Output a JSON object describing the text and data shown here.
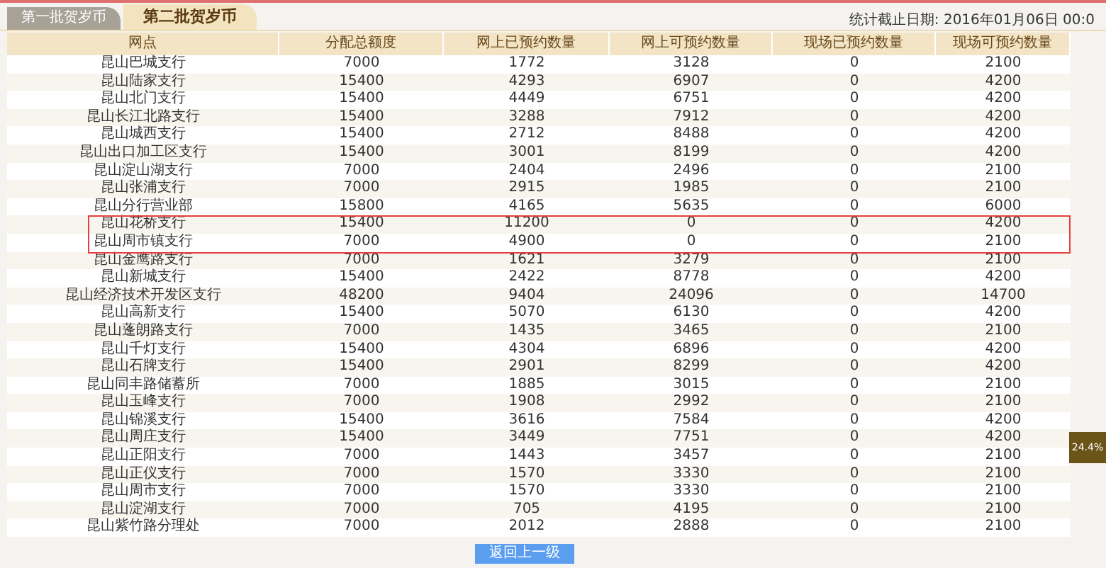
{
  "tabs": [
    {
      "label": "第一批贺岁币",
      "selected": false
    },
    {
      "label": "第二批贺岁币",
      "selected": true
    }
  ],
  "stat_date": "统计截止日期: 2016年01月06日 00:0",
  "table": {
    "columns": [
      "网点",
      "分配总额度",
      "网上已预约数量",
      "网上可预约数量",
      "现场已预约数量",
      "现场可预约数量"
    ],
    "rows": [
      {
        "cells": [
          "昆山巴城支行",
          "7000",
          "1772",
          "3128",
          "0",
          "2100"
        ],
        "highlighted": false
      },
      {
        "cells": [
          "昆山陆家支行",
          "15400",
          "4293",
          "6907",
          "0",
          "4200"
        ],
        "highlighted": false
      },
      {
        "cells": [
          "昆山北门支行",
          "15400",
          "4449",
          "6751",
          "0",
          "4200"
        ],
        "highlighted": false
      },
      {
        "cells": [
          "昆山长江北路支行",
          "15400",
          "3288",
          "7912",
          "0",
          "4200"
        ],
        "highlighted": false
      },
      {
        "cells": [
          "昆山城西支行",
          "15400",
          "2712",
          "8488",
          "0",
          "4200"
        ],
        "highlighted": false
      },
      {
        "cells": [
          "昆山出口加工区支行",
          "15400",
          "3001",
          "8199",
          "0",
          "4200"
        ],
        "highlighted": false
      },
      {
        "cells": [
          "昆山淀山湖支行",
          "7000",
          "2404",
          "2496",
          "0",
          "2100"
        ],
        "highlighted": false
      },
      {
        "cells": [
          "昆山张浦支行",
          "7000",
          "2915",
          "1985",
          "0",
          "2100"
        ],
        "highlighted": false
      },
      {
        "cells": [
          "昆山分行营业部",
          "15800",
          "4165",
          "5635",
          "0",
          "6000"
        ],
        "highlighted": false
      },
      {
        "cells": [
          "昆山花桥支行",
          "15400",
          "11200",
          "0",
          "0",
          "4200"
        ],
        "highlighted": true
      },
      {
        "cells": [
          "昆山周市镇支行",
          "7000",
          "4900",
          "0",
          "0",
          "2100"
        ],
        "highlighted": true
      },
      {
        "cells": [
          "昆山金鹰路支行",
          "7000",
          "1621",
          "3279",
          "0",
          "2100"
        ],
        "highlighted": false
      },
      {
        "cells": [
          "昆山新城支行",
          "15400",
          "2422",
          "8778",
          "0",
          "4200"
        ],
        "highlighted": false
      },
      {
        "cells": [
          "昆山经济技术开发区支行",
          "48200",
          "9404",
          "24096",
          "0",
          "14700"
        ],
        "highlighted": false
      },
      {
        "cells": [
          "昆山高新支行",
          "15400",
          "5070",
          "6130",
          "0",
          "4200"
        ],
        "highlighted": false
      },
      {
        "cells": [
          "昆山蓬朗路支行",
          "7000",
          "1435",
          "3465",
          "0",
          "2100"
        ],
        "highlighted": false
      },
      {
        "cells": [
          "昆山千灯支行",
          "15400",
          "4304",
          "6896",
          "0",
          "4200"
        ],
        "highlighted": false
      },
      {
        "cells": [
          "昆山石牌支行",
          "15400",
          "2901",
          "8299",
          "0",
          "4200"
        ],
        "highlighted": false
      },
      {
        "cells": [
          "昆山同丰路储蓄所",
          "7000",
          "1885",
          "3015",
          "0",
          "2100"
        ],
        "highlighted": false
      },
      {
        "cells": [
          "昆山玉峰支行",
          "7000",
          "1908",
          "2992",
          "0",
          "2100"
        ],
        "highlighted": false
      },
      {
        "cells": [
          "昆山锦溪支行",
          "15400",
          "3616",
          "7584",
          "0",
          "4200"
        ],
        "highlighted": false
      },
      {
        "cells": [
          "昆山周庄支行",
          "15400",
          "3449",
          "7751",
          "0",
          "4200"
        ],
        "highlighted": false
      },
      {
        "cells": [
          "昆山正阳支行",
          "7000",
          "1443",
          "3457",
          "0",
          "2100"
        ],
        "highlighted": false
      },
      {
        "cells": [
          "昆山正仪支行",
          "7000",
          "1570",
          "3330",
          "0",
          "2100"
        ],
        "highlighted": false
      },
      {
        "cells": [
          "昆山周市支行",
          "7000",
          "1570",
          "3330",
          "0",
          "2100"
        ],
        "highlighted": false
      },
      {
        "cells": [
          "昆山淀湖支行",
          "7000",
          "705",
          "4195",
          "0",
          "2100"
        ],
        "highlighted": false
      },
      {
        "cells": [
          "昆山紫竹路分理处",
          "7000",
          "2012",
          "2888",
          "0",
          "2100"
        ],
        "highlighted": false
      }
    ]
  },
  "back_button": "返回上一级",
  "progress_badge": "24.4%"
}
